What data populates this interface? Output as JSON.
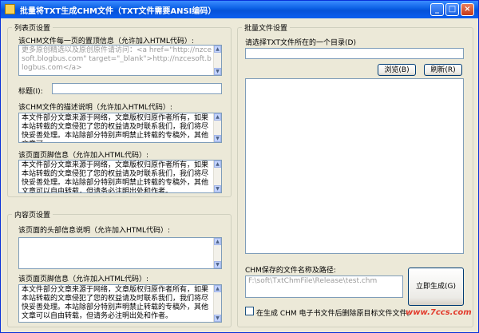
{
  "window": {
    "title": "批量将TXT生成CHM文件（TXT文件需要ANSI编码）",
    "controls": {
      "minimize": "_",
      "maximize": "□",
      "close": "×"
    }
  },
  "list_settings": {
    "legend": "列表页设置",
    "top_info_label": "该CHM文件每一页的置顶信息（允许加入HTML代码）:",
    "top_info_value": "更多原创精选以及原创原件请访问：<a href=\"http://nzcesoft.blogbus.com\" target=\"_blank\">http://nzcesoft.blogbus.com</a>",
    "title_label": "标题(I):",
    "title_value": "",
    "desc_label": "该CHM文件的描述说明（允许加入HTML代码）:",
    "desc_value": "本文件部分文章来源于网络，文章版权归原作者所有，如果本站转载的文章侵犯了您的权益请及时联系我们，我们将尽快妥善处理。本站除部分特别声明禁止转载的专稿外，其他文章可",
    "footer_label": "该页面页脚信息（允许加入HTML代码）:",
    "footer_value": "本文件部分文章来源于网络，文章版权归原作者所有，如果本站转载的文章侵犯了您的权益请及时联系我们，我们将尽快妥善处理。本站除部分特别声明禁止转载的专稿外，其他文章可以自由转载，但请务必注明出处和作者。"
  },
  "content_settings": {
    "legend": "内容页设置",
    "header_label": "该页面的头部信息说明（允许加入HTML代码）:",
    "header_value": "",
    "footer_label": "该页面页脚信息（允许加入HTML代码）:",
    "footer_value": "本文件部分文章来源于网络，文章版权归原作者所有，如果本站转载的文章侵犯了您的权益请及时联系我们，我们将尽快妥善处理。本站除部分特别声明禁止转载的专稿外，其他文章可以自由转载，但请务必注明出处和作者。"
  },
  "batch_settings": {
    "legend": "批量文件设置",
    "dir_label": "请选择TXT文件所在的一个目录(D)",
    "dir_value": "",
    "browse_button": "浏览(B)",
    "refresh_button": "刷新(R)",
    "chm_path_label": "CHM保存的文件名称及路径:",
    "chm_path_value": "F:\\soft\\TxtChmFile\\Release\\test.chm",
    "generate_button": "立即生成(G)",
    "delete_checkbox_label": "在生成 CHM 电子书文件后删除原目标文件文件。",
    "delete_checked": false
  },
  "watermark": {
    "text": "www.7ccs.com",
    "color": "#e23a2b"
  }
}
